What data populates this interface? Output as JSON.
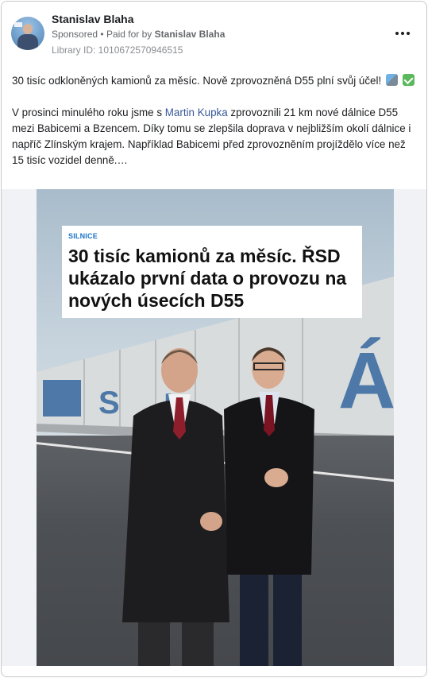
{
  "post": {
    "author": "Stanislav Blaha",
    "sponsored": "Sponsored",
    "separator": "•",
    "paid_for_prefix": "Paid for by",
    "paid_for_name": "Stanislav Blaha",
    "library_id": "Library ID: 1010672570946515",
    "line1": "30 tisíc odkloněných kamionů za měsíc. Nově zprovozněná D55 plní svůj účel!",
    "para2_before": "V prosinci minulého roku jsme s",
    "mention": "Martin Kupka",
    "para2_after": "zprovoznili 21 km nové dálnice D55 mezi Babicemi a Bzencem. Díky tomu se zlepšila doprava v nejbližším okolí dálnice i napříč Zlínským krajem. Například Babicemi před zprovozněním projíždělo více než 15 tisíc vozidel denně.…"
  },
  "media": {
    "tag": "SILNICE",
    "headline": "30 tisíc kamionů za měsíc. ŘSD ukázalo první data o provozu na nových úsecích D55",
    "barrier_letters": "SLÁ"
  },
  "icons": [
    "more-options-icon",
    "motorway-emoji-icon",
    "check-mark-emoji-icon"
  ],
  "colors": {
    "link": "#385898",
    "secondary_text": "#65676b",
    "tag_blue": "#1a73c8"
  }
}
